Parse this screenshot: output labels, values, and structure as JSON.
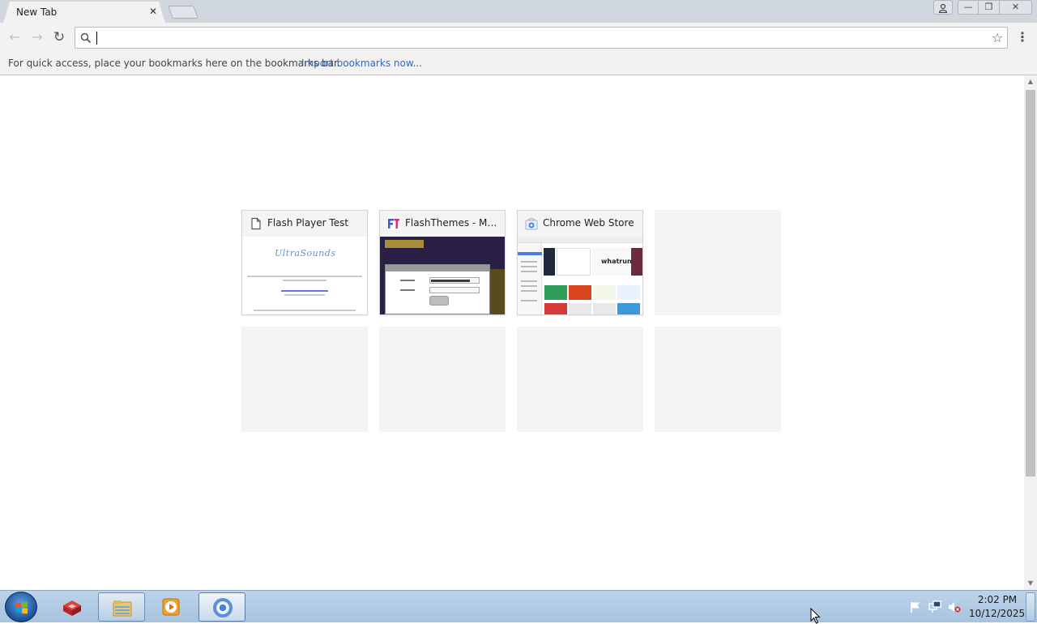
{
  "tabs": [
    {
      "title": "New Tab",
      "close_glyph": "✕",
      "active": true
    }
  ],
  "window_controls": {
    "profile_icon": "person-icon",
    "minimize_glyph": "—",
    "maximize_glyph": "❐",
    "close_glyph": "✕"
  },
  "toolbar": {
    "back_glyph": "←",
    "forward_glyph": "→",
    "reload_glyph": "↻",
    "omnibox_value": "",
    "star_glyph": "☆",
    "menu_glyph": "⋮"
  },
  "bookmarks_bar": {
    "message": "For quick access, place your bookmarks here on the bookmarks bar.",
    "import_link": "Import bookmarks now..."
  },
  "most_visited": [
    {
      "title": "Flash Player Test",
      "favicon": "page-icon",
      "thumb_logo": "UltraSounds"
    },
    {
      "title": "FlashThemes - Mak...",
      "favicon": "flashthemes-icon"
    },
    {
      "title": "Chrome Web Store",
      "favicon": "chrome-web-store-icon",
      "thumb_banner_text": "whatruns"
    }
  ],
  "taskbar": {
    "start_icon": "windows-start-icon",
    "pinned": [
      {
        "name": "toolbox-app-icon"
      },
      {
        "name": "file-explorer-icon"
      },
      {
        "name": "media-player-icon"
      },
      {
        "name": "chrome-icon"
      }
    ],
    "tray": [
      "action-center-flag-icon",
      "network-icon",
      "volume-muted-icon"
    ],
    "clock_time": "2:02 PM",
    "clock_date": "10/12/2025"
  },
  "colors": {
    "link": "#3366cc",
    "tab_strip": "#cfd6de",
    "toolbar": "#f2f2f2",
    "taskbar": "#a9c3de"
  }
}
